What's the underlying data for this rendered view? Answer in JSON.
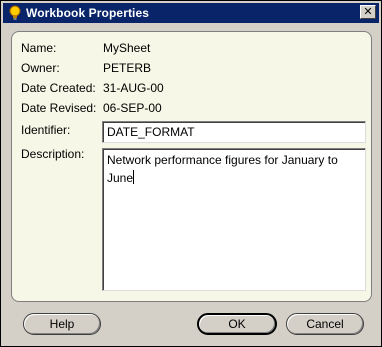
{
  "window": {
    "title": "Workbook Properties",
    "close_glyph": "✕",
    "icon": "bulb-icon"
  },
  "info": {
    "name_label": "Name:",
    "name_value": "MySheet",
    "owner_label": "Owner:",
    "owner_value": "PETERB",
    "created_label": "Date Created:",
    "created_value": "31-AUG-00",
    "revised_label": "Date Revised:",
    "revised_value": "06-SEP-00"
  },
  "form": {
    "identifier_label": "Identifier:",
    "identifier_value": "DATE_FORMAT",
    "description_label": "Description:",
    "description_value": "Network performance figures for January to June"
  },
  "buttons": {
    "help_label": "Help",
    "ok_label": "OK",
    "cancel_label": "Cancel"
  },
  "colors": {
    "titlebar": "#0a246a",
    "panel_bg": "#f7f7e7",
    "dialog_bg": "#d4d0c8"
  }
}
